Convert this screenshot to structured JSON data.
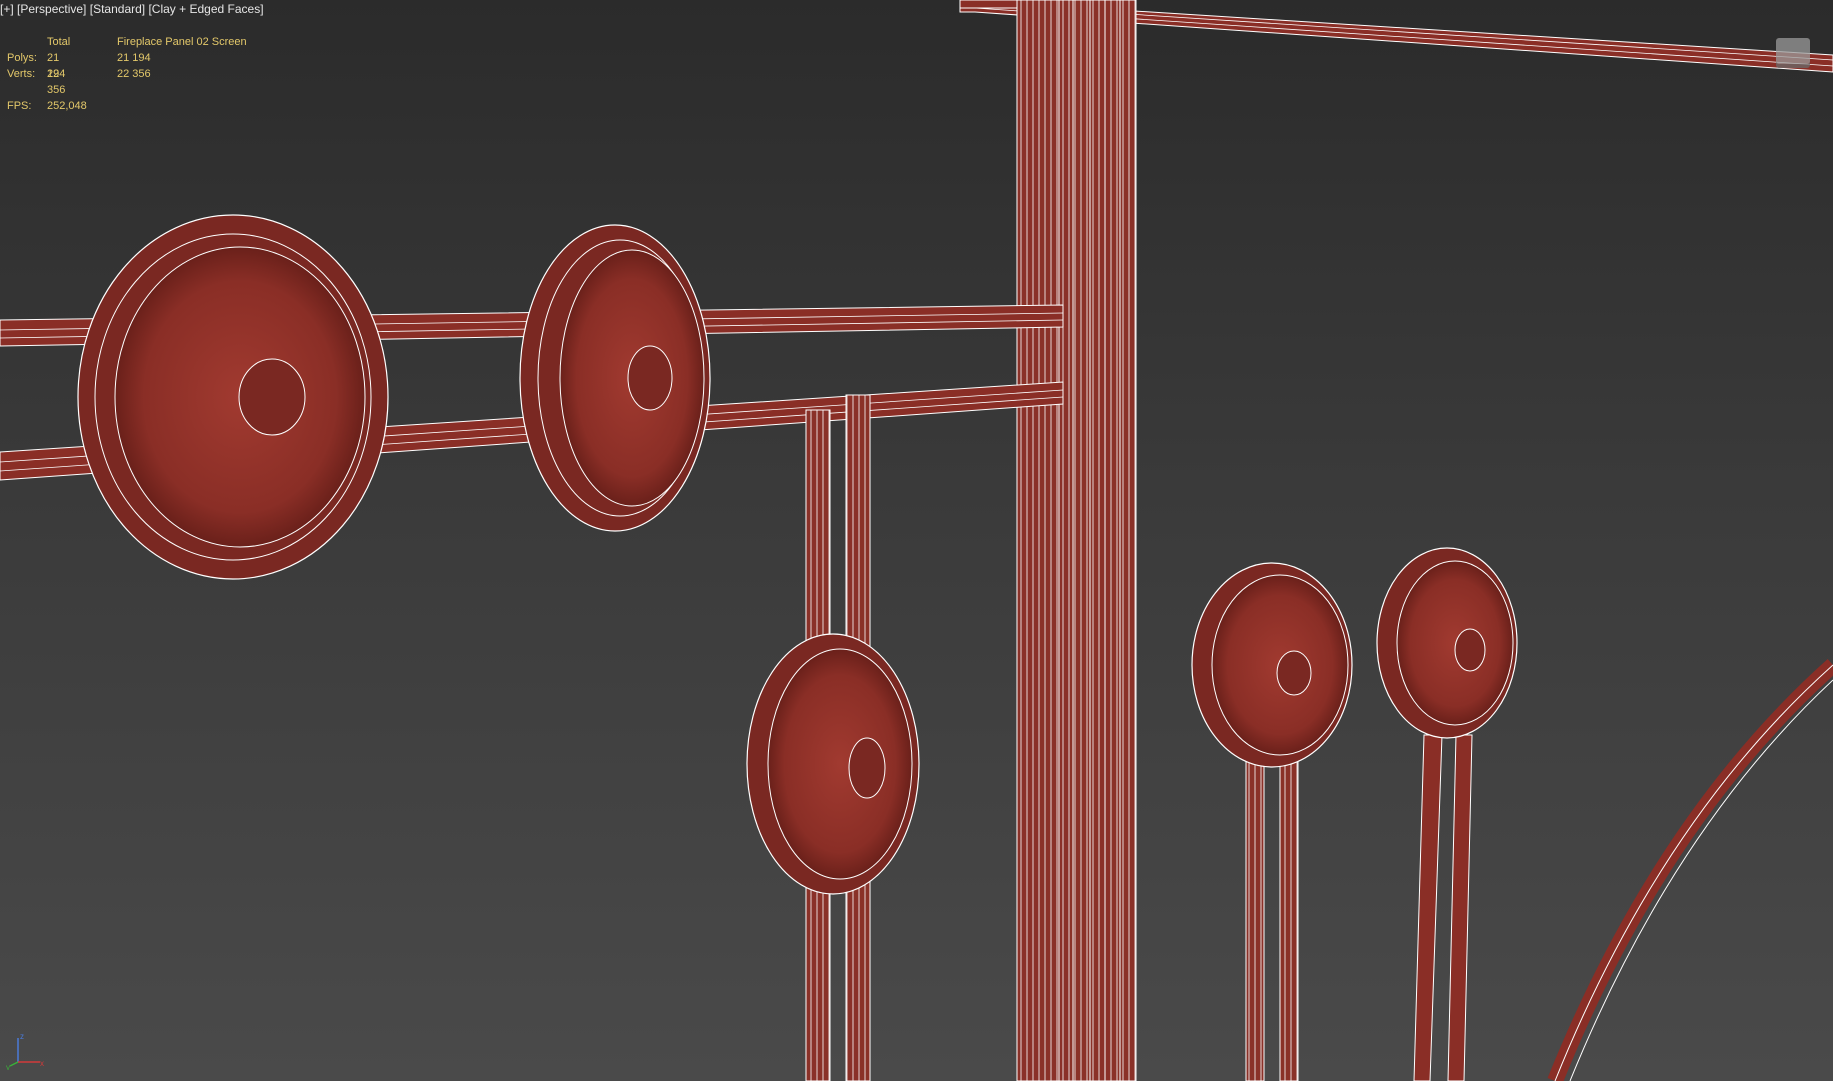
{
  "viewport": {
    "labels": [
      "[+]",
      "[Perspective]",
      "[Standard]",
      "[Clay + Edged Faces]"
    ]
  },
  "stats": {
    "header_total": "Total",
    "header_object": "Fireplace Panel 02 Screen",
    "polys_label": "Polys:",
    "polys_total": "21 194",
    "polys_object": "21 194",
    "verts_label": "Verts:",
    "verts_total": "22 356",
    "verts_object": "22 356",
    "fps_label": "FPS:",
    "fps_value": "252,048"
  },
  "colors": {
    "model_fill": "#8a2e26",
    "model_dark": "#5c1a15",
    "wire": "#ffffff",
    "stats_text": "#e3c86a",
    "axis_x": "#d23a3a",
    "axis_y": "#3ab03a",
    "axis_z": "#4a7ad8"
  },
  "gizmo": {
    "x_label": "x",
    "y_label": "y",
    "z_label": "z"
  },
  "viewcube": {
    "icon": "viewcube-icon"
  }
}
